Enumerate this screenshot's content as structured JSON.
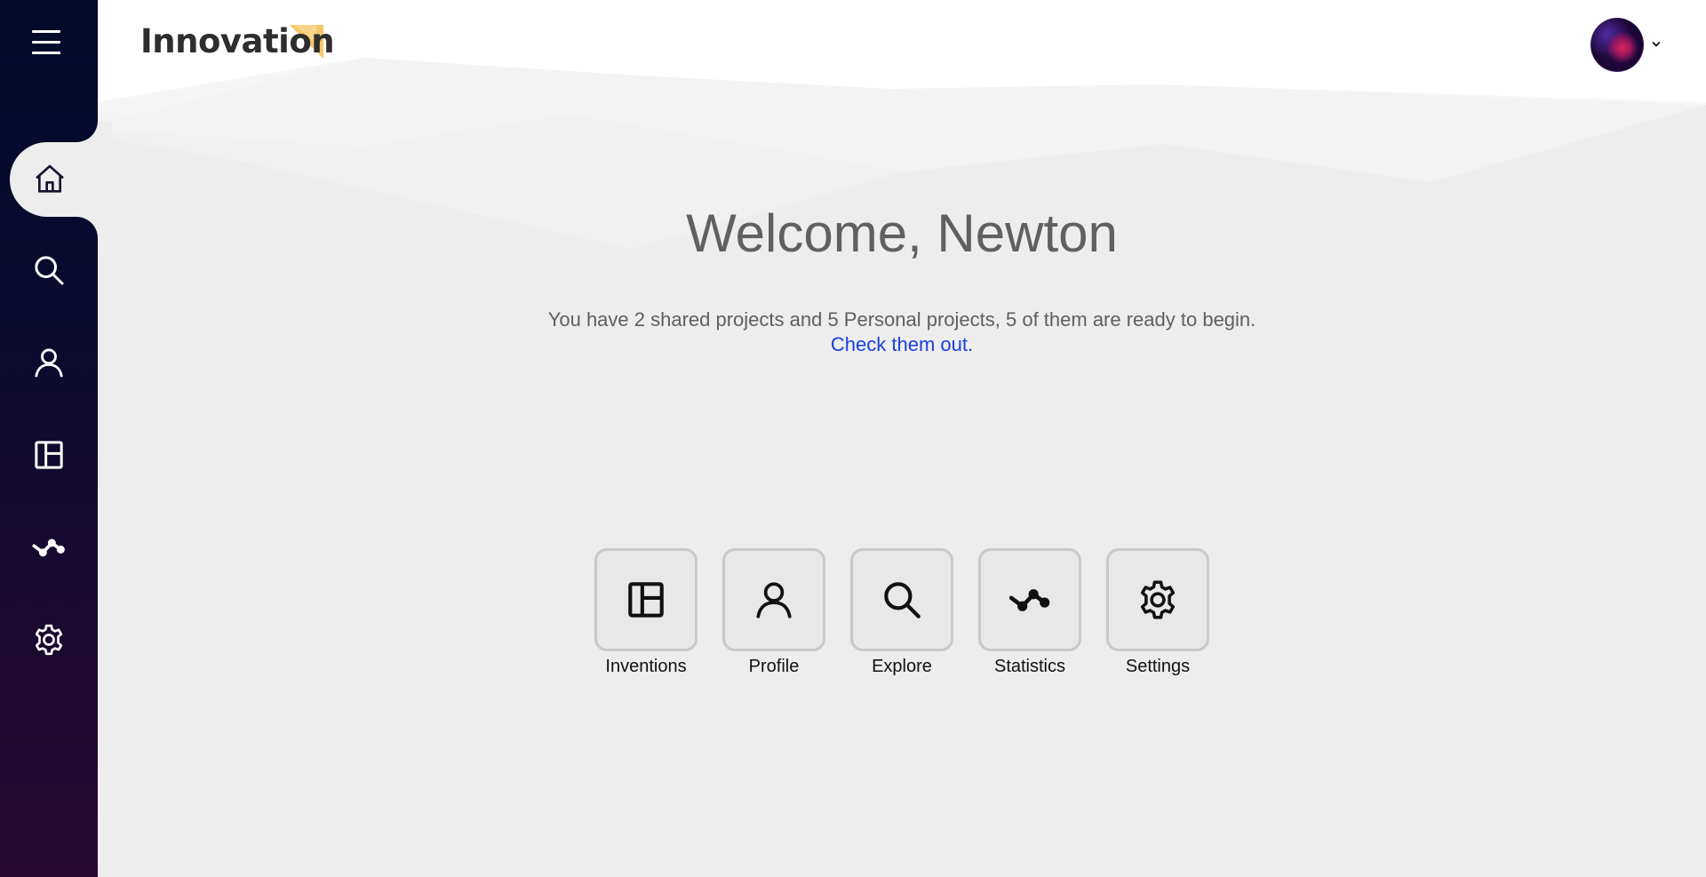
{
  "header": {
    "logo_text": "Innovation",
    "accent_color": "#f5c76a"
  },
  "sidebar": {
    "menu_icon": "hamburger-icon",
    "items": [
      {
        "label": "Home",
        "icon": "home-icon",
        "active": true
      },
      {
        "label": "Search",
        "icon": "search-icon",
        "active": false
      },
      {
        "label": "Profile",
        "icon": "user-icon",
        "active": false
      },
      {
        "label": "Inventions",
        "icon": "layout-icon",
        "active": false
      },
      {
        "label": "Statistics",
        "icon": "chart-icon",
        "active": false
      },
      {
        "label": "Settings",
        "icon": "gear-icon",
        "active": false
      }
    ]
  },
  "user_menu": {
    "avatar": "avatar-image",
    "dropdown_icon": "chevron-down-icon"
  },
  "main": {
    "welcome": "Welcome, Newton",
    "summary": "You have 2 shared projects and 5 Personal projects, 5 of them are ready to begin.",
    "link": "Check them out.",
    "tiles": [
      {
        "label": "Inventions",
        "icon": "layout-icon"
      },
      {
        "label": "Profile",
        "icon": "user-icon"
      },
      {
        "label": "Explore",
        "icon": "search-icon"
      },
      {
        "label": "Statistics",
        "icon": "chart-icon"
      },
      {
        "label": "Settings",
        "icon": "gear-icon"
      }
    ]
  }
}
